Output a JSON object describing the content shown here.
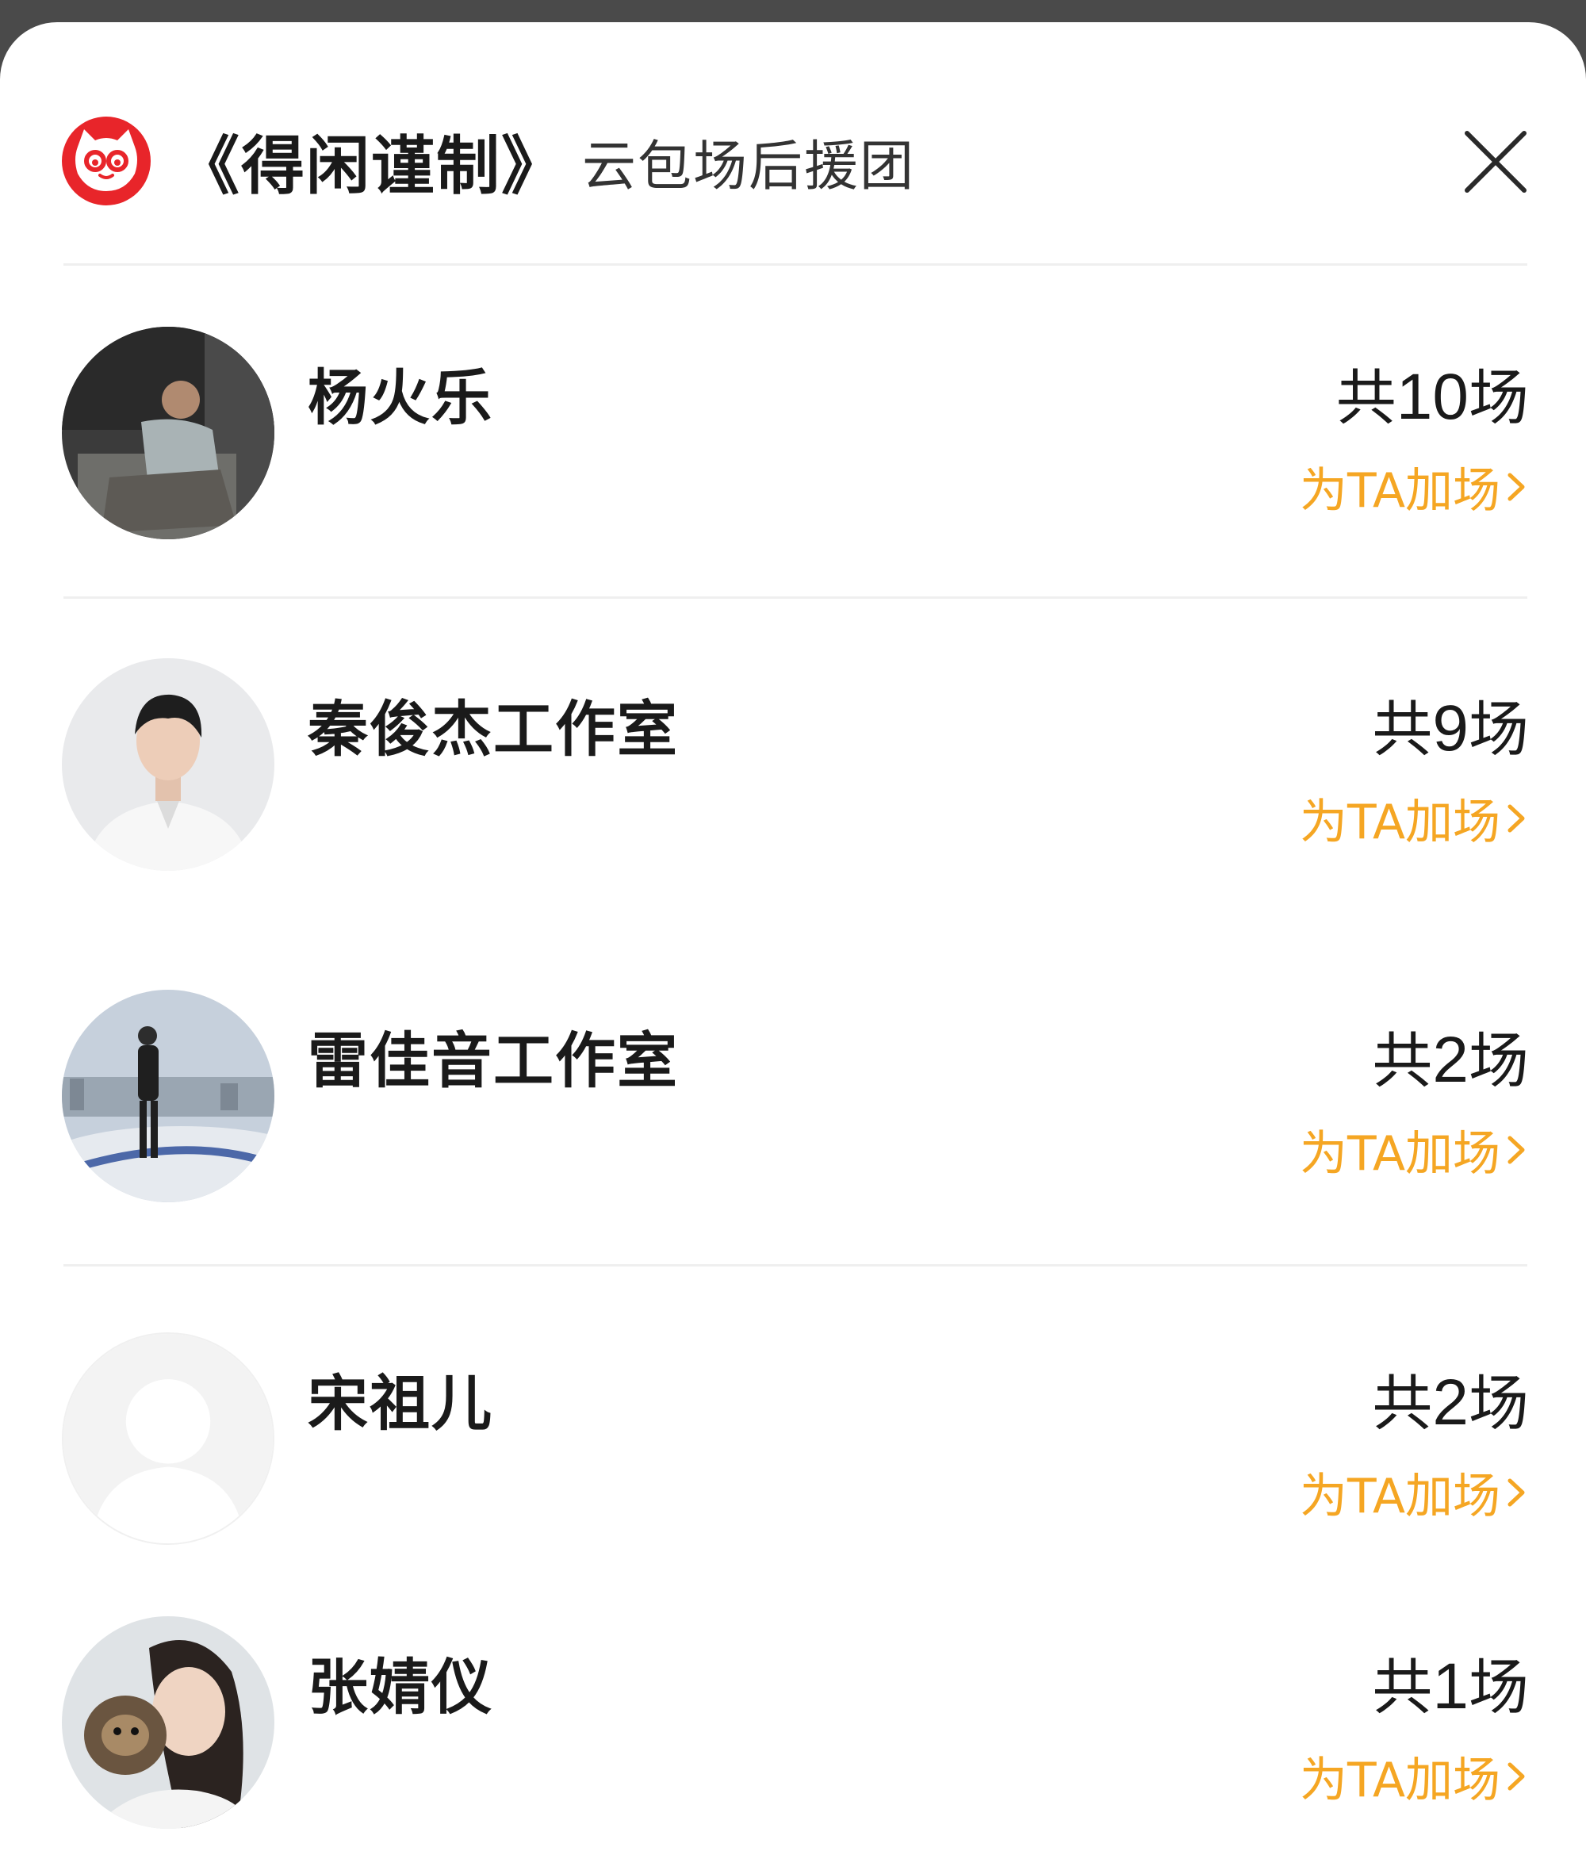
{
  "header": {
    "title": "《得闲谨制》",
    "subtitle": "云包场后援团",
    "logo_icon": "maoyan-cat-logo-icon",
    "close_icon": "close-icon"
  },
  "colors": {
    "accent": "#f5a623",
    "logo_red": "#e8252a",
    "text": "#1a1a1a",
    "divider": "#efefef"
  },
  "supporters": [
    {
      "name": "杨火乐",
      "count_prefix": "共",
      "count": "10",
      "count_suffix": "场",
      "action": "为TA加场"
    },
    {
      "name": "秦俊杰工作室",
      "count_prefix": "共",
      "count": "9",
      "count_suffix": "场",
      "action": "为TA加场"
    },
    {
      "name": "雷佳音工作室",
      "count_prefix": "共",
      "count": "2",
      "count_suffix": "场",
      "action": "为TA加场"
    },
    {
      "name": "宋祖儿",
      "count_prefix": "共",
      "count": "2",
      "count_suffix": "场",
      "action": "为TA加场"
    },
    {
      "name": "张婧仪",
      "count_prefix": "共",
      "count": "1",
      "count_suffix": "场",
      "action": "为TA加场"
    }
  ]
}
